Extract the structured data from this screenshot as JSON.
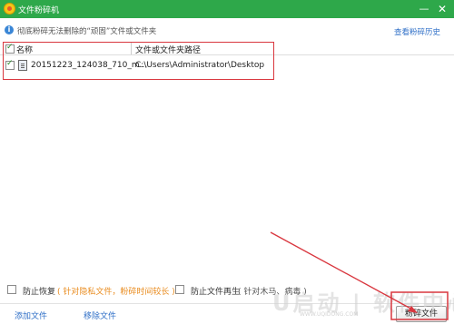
{
  "window": {
    "title": "文件粉碎机"
  },
  "info": {
    "text": "彻底粉碎无法删除的“顽固”文件或文件夹",
    "history_link": "查看粉碎历史"
  },
  "table": {
    "columns": {
      "name": "名称",
      "path": "文件或文件夹路径"
    },
    "rows": [
      {
        "name": "20151223_124038_710_m...",
        "path": "C:\\Users\\Administrator\\Desktop",
        "checked": true
      }
    ]
  },
  "options": {
    "prevent_recovery": {
      "label": "防止恢复",
      "hint": "( 针对隐私文件，粉碎时间较长 )"
    },
    "prevent_regen": {
      "label": "防止文件再生",
      "hint": "( 针对木马、病毒 )"
    }
  },
  "footer": {
    "add_label": "添加文件",
    "remove_label": "移除文件",
    "shred_label": "粉碎文件"
  },
  "watermark": {
    "text": "U启动 | 软件中心",
    "url": "WWW.UQIDONG.COM"
  },
  "colors": {
    "titlebar": "#2ea84a",
    "link": "#2f6fc7",
    "hint_orange": "#e98b1e",
    "annotation_red": "#d9363e"
  },
  "icons": [
    "app-icon",
    "minimize-icon",
    "close-icon",
    "info-icon",
    "file-icon",
    "arrow-annotation"
  ]
}
